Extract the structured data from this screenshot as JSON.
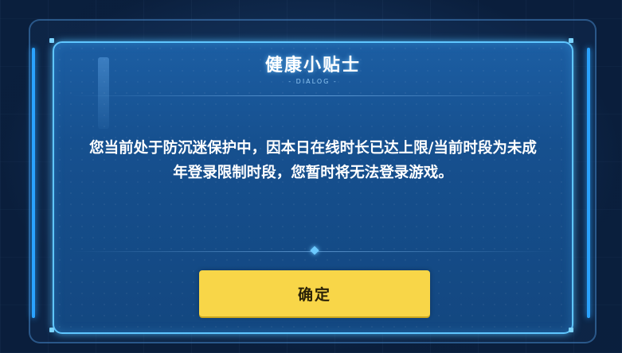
{
  "dialog": {
    "title": "健康小贴士",
    "subtitle": "- DIALOG -",
    "message": "您当前处于防沉迷保护中，因本日在线时长已达上限/当前时段为未成年登录限制时段，您暂时将无法登录游戏。",
    "confirm_label": "确定"
  },
  "colors": {
    "accent": "#5fc6ff",
    "button": "#f8d648",
    "dialog_bg": "#1c5ea3"
  }
}
